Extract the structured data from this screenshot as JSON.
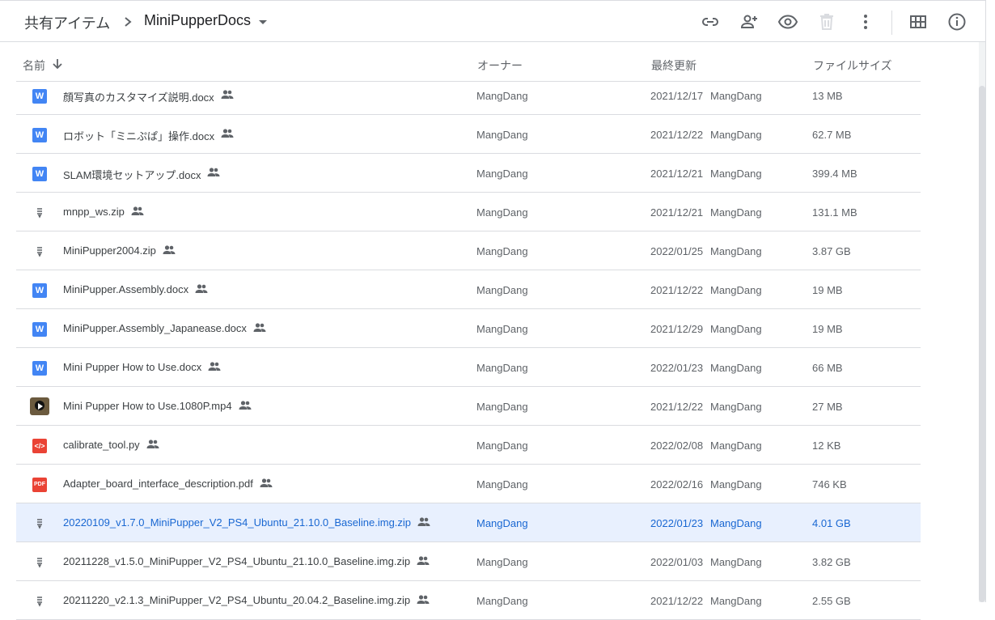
{
  "breadcrumb": {
    "root": "共有アイテム",
    "current": "MiniPupperDocs"
  },
  "toolbar": {
    "icons": [
      "link-icon",
      "add-person-icon",
      "preview-eye-icon",
      "trash-icon",
      "more-vert-icon",
      "grid-view-icon",
      "info-icon"
    ]
  },
  "columns": {
    "name": "名前",
    "owner": "オーナー",
    "modified": "最終更新",
    "size": "ファイルサイズ"
  },
  "files": [
    {
      "name": "顔写真のカスタマイズ説明.docx",
      "type": "doc",
      "owner": "MangDang",
      "date": "2021/12/17",
      "by": "MangDang",
      "size": "13 MB"
    },
    {
      "name": "ロボット「ミニぷぱ」操作.docx",
      "type": "doc",
      "owner": "MangDang",
      "date": "2021/12/22",
      "by": "MangDang",
      "size": "62.7 MB"
    },
    {
      "name": "SLAM環境セットアップ.docx",
      "type": "doc",
      "owner": "MangDang",
      "date": "2021/12/21",
      "by": "MangDang",
      "size": "399.4 MB"
    },
    {
      "name": "mnpp_ws.zip",
      "type": "zip",
      "owner": "MangDang",
      "date": "2021/12/21",
      "by": "MangDang",
      "size": "131.1 MB"
    },
    {
      "name": "MiniPupper2004.zip",
      "type": "zip",
      "owner": "MangDang",
      "date": "2022/01/25",
      "by": "MangDang",
      "size": "3.87 GB"
    },
    {
      "name": "MiniPupper.Assembly.docx",
      "type": "doc",
      "owner": "MangDang",
      "date": "2021/12/22",
      "by": "MangDang",
      "size": "19 MB"
    },
    {
      "name": "MiniPupper.Assembly_Japanease.docx",
      "type": "doc",
      "owner": "MangDang",
      "date": "2021/12/29",
      "by": "MangDang",
      "size": "19 MB"
    },
    {
      "name": "Mini Pupper How to Use.docx",
      "type": "doc",
      "owner": "MangDang",
      "date": "2022/01/23",
      "by": "MangDang",
      "size": "66 MB"
    },
    {
      "name": "Mini Pupper How to Use.1080P.mp4",
      "type": "video",
      "owner": "MangDang",
      "date": "2021/12/22",
      "by": "MangDang",
      "size": "27 MB"
    },
    {
      "name": "calibrate_tool.py",
      "type": "code",
      "owner": "MangDang",
      "date": "2022/02/08",
      "by": "MangDang",
      "size": "12 KB"
    },
    {
      "name": "Adapter_board_interface_description.pdf",
      "type": "pdf",
      "owner": "MangDang",
      "date": "2022/02/16",
      "by": "MangDang",
      "size": "746 KB"
    },
    {
      "name": "20220109_v1.7.0_MiniPupper_V2_PS4_Ubuntu_21.10.0_Baseline.img.zip",
      "type": "zip",
      "owner": "MangDang",
      "date": "2022/01/23",
      "by": "MangDang",
      "size": "4.01 GB",
      "selected": true
    },
    {
      "name": "20211228_v1.5.0_MiniPupper_V2_PS4_Ubuntu_21.10.0_Baseline.img.zip",
      "type": "zip",
      "owner": "MangDang",
      "date": "2022/01/03",
      "by": "MangDang",
      "size": "3.82 GB"
    },
    {
      "name": "20211220_v2.1.3_MiniPupper_V2_PS4_Ubuntu_20.04.2_Baseline.img.zip",
      "type": "zip",
      "owner": "MangDang",
      "date": "2021/12/22",
      "by": "MangDang",
      "size": "2.55 GB"
    }
  ],
  "colors": {
    "selected_bg": "#e8f0fe",
    "selected_text": "#1967d2",
    "doc_icon": "#4285f4",
    "pdf_icon": "#ea4335"
  }
}
